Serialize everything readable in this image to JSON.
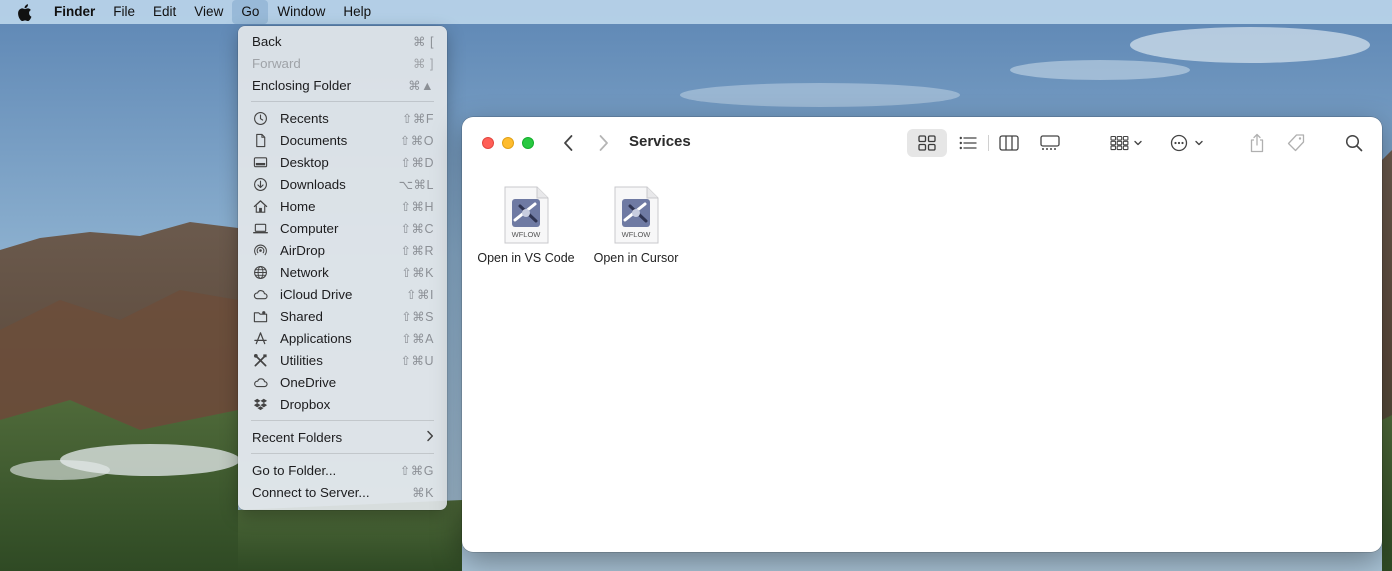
{
  "menubar": {
    "app_name": "Finder",
    "items": [
      "File",
      "Edit",
      "View",
      "Go",
      "Window",
      "Help"
    ],
    "active_item": "Go"
  },
  "go_menu": {
    "back": {
      "label": "Back",
      "shortcut": "⌘ ["
    },
    "forward": {
      "label": "Forward",
      "shortcut": "⌘ ]"
    },
    "enclosing": {
      "label": "Enclosing Folder",
      "shortcut": "⌘▲"
    },
    "places": [
      {
        "label": "Recents",
        "shortcut": "⇧⌘F",
        "icon": "clock-icon"
      },
      {
        "label": "Documents",
        "shortcut": "⇧⌘O",
        "icon": "document-icon"
      },
      {
        "label": "Desktop",
        "shortcut": "⇧⌘D",
        "icon": "desktop-icon"
      },
      {
        "label": "Downloads",
        "shortcut": "⌥⌘L",
        "icon": "download-icon"
      },
      {
        "label": "Home",
        "shortcut": "⇧⌘H",
        "icon": "home-icon"
      },
      {
        "label": "Computer",
        "shortcut": "⇧⌘C",
        "icon": "laptop-icon"
      },
      {
        "label": "AirDrop",
        "shortcut": "⇧⌘R",
        "icon": "airdrop-icon"
      },
      {
        "label": "Network",
        "shortcut": "⇧⌘K",
        "icon": "globe-icon"
      },
      {
        "label": "iCloud Drive",
        "shortcut": "⇧⌘I",
        "icon": "cloud-icon"
      },
      {
        "label": "Shared",
        "shortcut": "⇧⌘S",
        "icon": "shared-folder-icon"
      },
      {
        "label": "Applications",
        "shortcut": "⇧⌘A",
        "icon": "applications-icon"
      },
      {
        "label": "Utilities",
        "shortcut": "⇧⌘U",
        "icon": "utilities-icon"
      },
      {
        "label": "OneDrive",
        "shortcut": "",
        "icon": "cloud-icon"
      },
      {
        "label": "Dropbox",
        "shortcut": "",
        "icon": "dropbox-icon"
      }
    ],
    "recent_folders": {
      "label": "Recent Folders"
    },
    "go_to_folder": {
      "label": "Go to Folder...",
      "shortcut": "⇧⌘G"
    },
    "connect_server": {
      "label": "Connect to Server...",
      "shortcut": "⌘K"
    }
  },
  "window": {
    "title": "Services",
    "files": [
      {
        "name": "Open in VS Code",
        "badge": "WFLOW"
      },
      {
        "name": "Open in Cursor",
        "badge": "WFLOW"
      }
    ]
  },
  "colors": {
    "close": "#ff5f57",
    "minimize": "#febc2e",
    "zoom": "#28c840",
    "menubar": "#c6def0"
  }
}
